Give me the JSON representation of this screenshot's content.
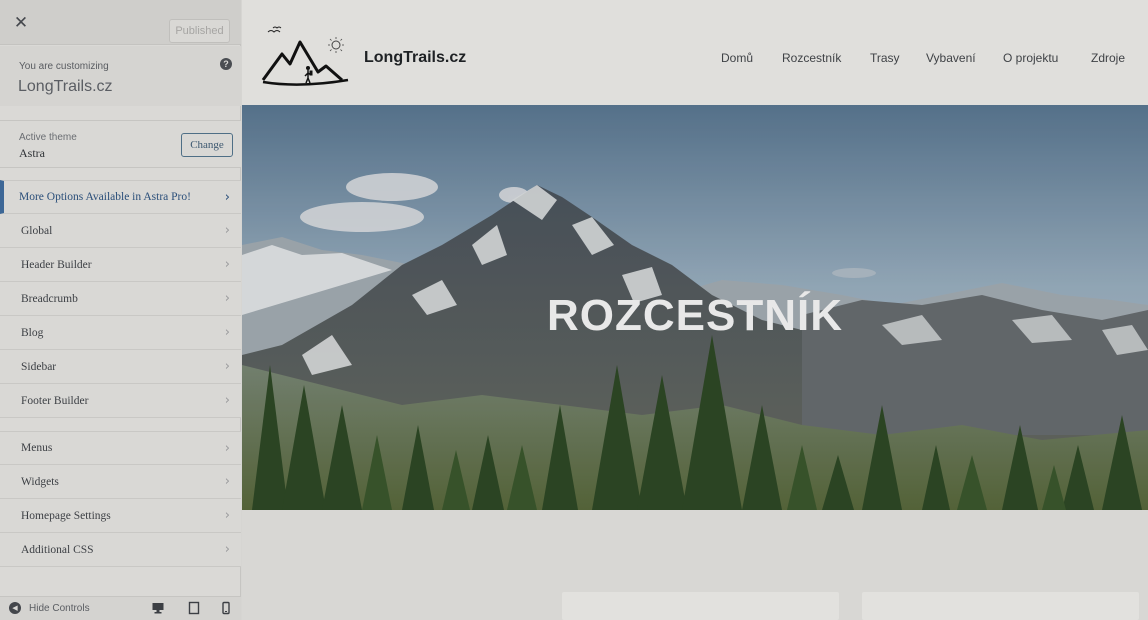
{
  "customizer": {
    "close_label": "✕",
    "publish_label": "Published",
    "customizing_label": "You are customizing",
    "site_name": "LongTrails.cz",
    "help_icon": "?",
    "active_theme_label": "Active theme",
    "active_theme_name": "Astra",
    "change_label": "Change",
    "promo_label": "More Options Available in Astra Pro!",
    "sections_group1": [
      "Global",
      "Header Builder",
      "Breadcrumb",
      "Blog",
      "Sidebar",
      "Footer Builder"
    ],
    "sections_group2": [
      "Menus",
      "Widgets",
      "Homepage Settings",
      "Additional CSS"
    ],
    "hide_controls_label": "Hide Controls",
    "device_icons": [
      "desktop-icon",
      "tablet-icon",
      "mobile-icon"
    ]
  },
  "preview": {
    "site_title": "LongTrails.cz",
    "nav": [
      "Domů",
      "Rozcestník",
      "Trasy",
      "Vybavení",
      "O projektu",
      "Zdroje"
    ],
    "hero_title": "ROZCESTNÍK"
  },
  "colors": {
    "promo": "#2a4e79",
    "sidebar_bg": "#dad9d6",
    "header_bg": "#e0dfdc"
  }
}
